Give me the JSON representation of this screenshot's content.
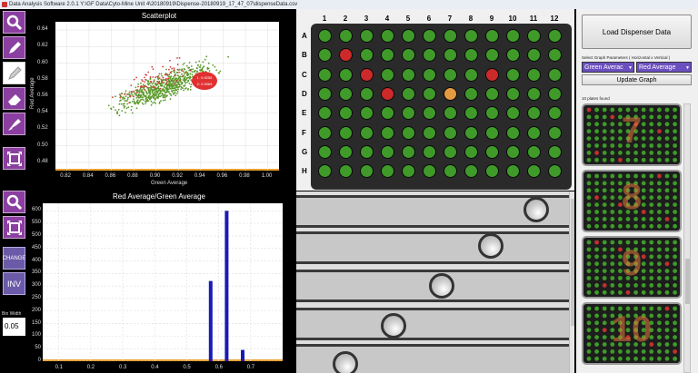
{
  "window": {
    "title": "Data Analysis Software 2.0.1 Y:\\GF Data\\Cyto-Mine Unit 4\\20180919\\Dispense-20180919_17_47_07\\dispenseData.csv"
  },
  "tools": {
    "zoom_icon": "zoom-icon",
    "pencil_icon": "pencil-icon",
    "pencil_white_icon": "pencil-white-icon",
    "eraser_icon": "eraser-icon",
    "brush_icon": "brush-icon",
    "fit_icon": "fit-icon",
    "zoom_icon_2": "zoom-icon",
    "fit_icon_2": "fit-icon",
    "change_label": "CHANGE",
    "inv_label": "INV",
    "bin_width_label": "Bin Width",
    "bin_width_value": "0.05"
  },
  "scatter": {
    "title": "Scatterplot",
    "xlabel": "Green Average",
    "ylabel": "Red Average",
    "highlight_label_1": "1. 0.9255",
    "highlight_label_2": "2: 0.5969"
  },
  "histogram": {
    "title": "Red Average/Green Average"
  },
  "chart_data": [
    {
      "type": "scatter",
      "title": "Scatterplot",
      "xlabel": "Green Average",
      "ylabel": "Red Average",
      "xlim": [
        0.81,
        1.01
      ],
      "ylim": [
        0.47,
        0.65
      ],
      "x_ticks": [
        "0.82",
        "0.84",
        "0.86",
        "0.88",
        "0.90",
        "0.92",
        "0.94",
        "0.96",
        "0.98",
        "1.00"
      ],
      "y_ticks": [
        "0.48",
        "0.50",
        "0.52",
        "0.54",
        "0.56",
        "0.58",
        "0.60",
        "0.62",
        "0.64"
      ],
      "series": [
        {
          "color": "#5a9a2a",
          "cluster": {
            "x_range": [
              0.86,
              0.975
            ],
            "y_range": [
              0.53,
              0.62
            ],
            "center": [
              0.91,
              0.573
            ]
          }
        },
        {
          "color": "#d04040",
          "cluster": {
            "x_range": [
              0.85,
              0.96
            ],
            "y_range": [
              0.54,
              0.62
            ],
            "center": [
              0.9,
              0.58
            ]
          }
        }
      ],
      "highlight": {
        "x": 0.9255,
        "y": 0.5969,
        "color": "#e03030"
      },
      "grid": true
    },
    {
      "type": "bar",
      "title": "Red Average/Green Average",
      "xlim": [
        0.05,
        0.8
      ],
      "ylim": [
        0,
        630
      ],
      "x_ticks": [
        "0.1",
        "0.2",
        "0.3",
        "0.4",
        "0.5",
        "0.6",
        "0.7"
      ],
      "y_ticks": [
        "0",
        "50",
        "100",
        "150",
        "200",
        "250",
        "300",
        "350",
        "400",
        "450",
        "500",
        "550",
        "600"
      ],
      "bars": [
        {
          "x": 0.575,
          "value": 320
        },
        {
          "x": 0.625,
          "value": 600
        },
        {
          "x": 0.675,
          "value": 45
        }
      ],
      "bar_color": "#1a1ab4",
      "grid": true
    }
  ],
  "plate": {
    "columns": [
      "1",
      "2",
      "3",
      "4",
      "5",
      "6",
      "7",
      "8",
      "9",
      "10",
      "11",
      "12"
    ],
    "rows": [
      "A",
      "B",
      "C",
      "D",
      "E",
      "F",
      "G",
      "H"
    ],
    "well_color": "#3f9a2a",
    "highlighted": [
      {
        "row": "B",
        "col": 2,
        "color": "#cc2a2a"
      },
      {
        "row": "C",
        "col": 3,
        "color": "#cc2a2a"
      },
      {
        "row": "C",
        "col": 9,
        "color": "#cc2a2a"
      },
      {
        "row": "D",
        "col": 4,
        "color": "#cc2a2a"
      },
      {
        "row": "D",
        "col": 7,
        "color": "#e69a40"
      }
    ]
  },
  "right_panel": {
    "load_button": "Load Dispenser Data",
    "select_label": "Select Graph Parameters ( Horizontal x Vertical )",
    "horizontal_param": "Green Averac",
    "vertical_param": "Red Average",
    "update_button": "Update Graph",
    "plates_found": "10 plates found",
    "thumbnails": [
      "7",
      "8",
      "9",
      "10"
    ]
  }
}
